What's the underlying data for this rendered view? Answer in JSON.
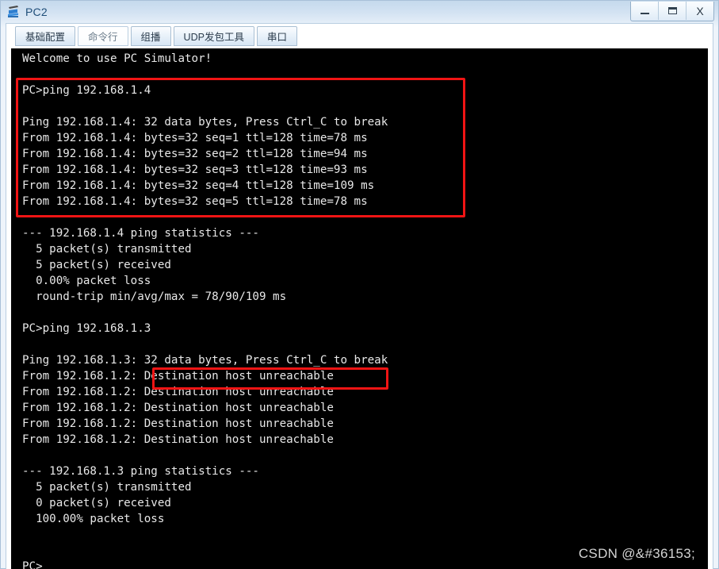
{
  "window": {
    "title": "PC2",
    "icon": "pc-computer-icon",
    "controls": {
      "minimize_label": "–",
      "maximize_label": "▭",
      "close_label": "X",
      "minimize_name": "minimize",
      "maximize_name": "maximize",
      "close_name": "close"
    }
  },
  "tabs": [
    {
      "label": "基础配置",
      "selected": false
    },
    {
      "label": "命令行",
      "selected": true
    },
    {
      "label": "组播",
      "selected": false
    },
    {
      "label": "UDP发包工具",
      "selected": false
    },
    {
      "label": "串口",
      "selected": false
    }
  ],
  "terminal": {
    "prompt": "PC>",
    "background_color": "#000000",
    "text_color": "#e8e8e8",
    "lines": [
      "Welcome to use PC Simulator!",
      "",
      "PC>ping 192.168.1.4",
      "",
      "Ping 192.168.1.4: 32 data bytes, Press Ctrl_C to break",
      "From 192.168.1.4: bytes=32 seq=1 ttl=128 time=78 ms",
      "From 192.168.1.4: bytes=32 seq=2 ttl=128 time=94 ms",
      "From 192.168.1.4: bytes=32 seq=3 ttl=128 time=93 ms",
      "From 192.168.1.4: bytes=32 seq=4 ttl=128 time=109 ms",
      "From 192.168.1.4: bytes=32 seq=5 ttl=128 time=78 ms",
      "",
      "--- 192.168.1.4 ping statistics ---",
      "  5 packet(s) transmitted",
      "  5 packet(s) received",
      "  0.00% packet loss",
      "  round-trip min/avg/max = 78/90/109 ms",
      "",
      "PC>ping 192.168.1.3",
      "",
      "Ping 192.168.1.3: 32 data bytes, Press Ctrl_C to break",
      "From 192.168.1.2: Destination host unreachable",
      "From 192.168.1.2: Destination host unreachable",
      "From 192.168.1.2: Destination host unreachable",
      "From 192.168.1.2: Destination host unreachable",
      "From 192.168.1.2: Destination host unreachable",
      "",
      "--- 192.168.1.3 ping statistics ---",
      "  5 packet(s) transmitted",
      "  0 packet(s) received",
      "  100.00% packet loss",
      "",
      "",
      "PC>"
    ]
  },
  "annotations": {
    "color": "#f01414",
    "boxes": [
      {
        "name": "redbox-ping-success",
        "note": ""
      },
      {
        "name": "redbox-unreachable",
        "note": ""
      }
    ]
  },
  "watermark": {
    "text": "CSDN @&#36153;"
  }
}
